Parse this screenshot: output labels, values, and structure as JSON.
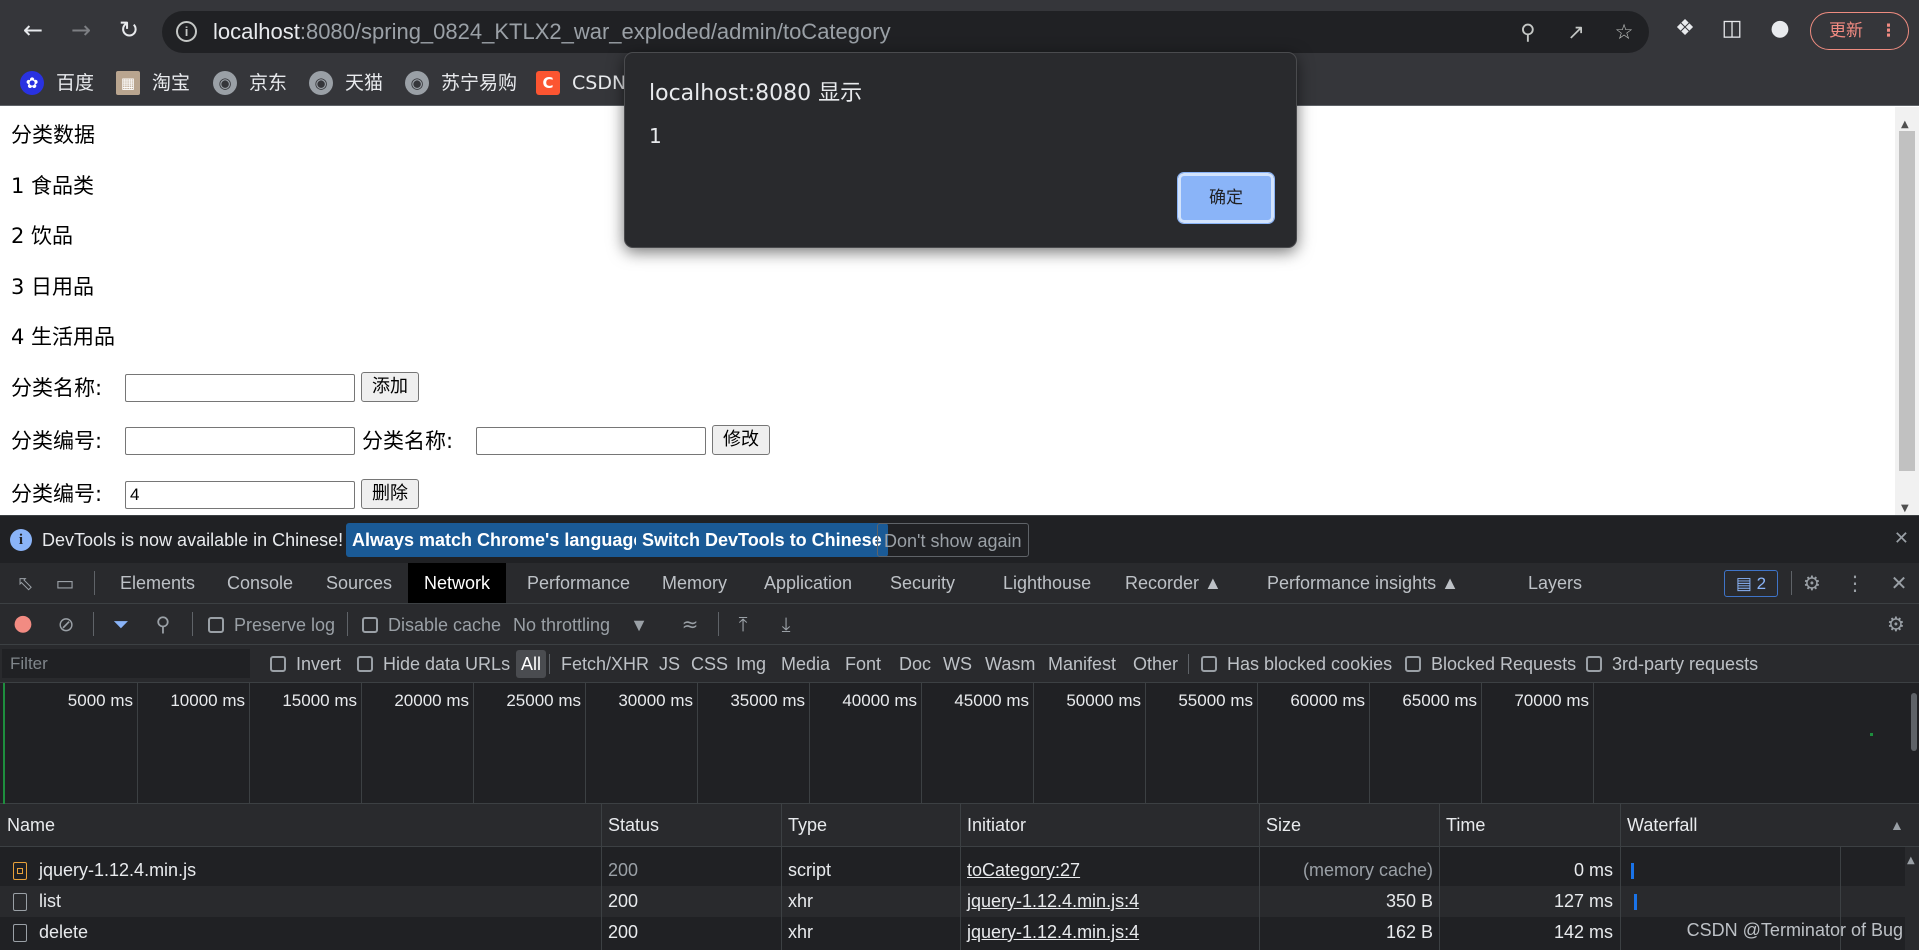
{
  "browser": {
    "url_host": "localhost",
    "url_rest": ":8080/spring_0824_KTLX2_war_exploded/admin/toCategory",
    "update_label": "更新",
    "bookmarks": [
      {
        "label": "百度",
        "icon": "baidu-icon"
      },
      {
        "label": "淘宝",
        "icon": "taobao-icon"
      },
      {
        "label": "京东",
        "icon": "globe-icon"
      },
      {
        "label": "天猫",
        "icon": "globe-icon"
      },
      {
        "label": "苏宁易购",
        "icon": "globe-icon"
      },
      {
        "label": "CSDN",
        "icon": "csdn-icon"
      }
    ]
  },
  "page": {
    "heading": "分类数据",
    "categories": [
      "1 食品类",
      "2 饮品",
      "3 日用品",
      "4 生活用品"
    ],
    "add_form": {
      "label": "分类名称:",
      "value": "",
      "button": "添加"
    },
    "update_form": {
      "id_label": "分类编号:",
      "id_value": "",
      "name_label": "分类名称:",
      "name_value": "",
      "button": "修改"
    },
    "delete_form": {
      "label": "分类编号:",
      "value": "4",
      "button": "删除"
    }
  },
  "alert": {
    "title": "localhost:8080 显示",
    "message": "1",
    "ok_label": "确定"
  },
  "devtools": {
    "banner": {
      "text": "DevTools is now available in Chinese!",
      "btn_match": "Always match Chrome's language",
      "btn_switch": "Switch DevTools to Chinese",
      "btn_dismiss": "Don't show again"
    },
    "tabs": [
      "Elements",
      "Console",
      "Sources",
      "Network",
      "Performance",
      "Memory",
      "Application",
      "Security",
      "Lighthouse",
      "Recorder",
      "Performance insights",
      "Layers"
    ],
    "active_tab": "Network",
    "issues_count": "2",
    "network_toolbar": {
      "preserve_log": "Preserve log",
      "disable_cache": "Disable cache",
      "throttling": "No throttling"
    },
    "filter": {
      "placeholder": "Filter",
      "invert": "Invert",
      "hide_data_urls": "Hide data URLs",
      "types": [
        "All",
        "Fetch/XHR",
        "JS",
        "CSS",
        "Img",
        "Media",
        "Font",
        "Doc",
        "WS",
        "Wasm",
        "Manifest",
        "Other"
      ],
      "active_type": "All",
      "has_blocked_cookies": "Has blocked cookies",
      "blocked_requests": "Blocked Requests",
      "third_party": "3rd-party requests"
    },
    "timeline_ticks": [
      "5000 ms",
      "10000 ms",
      "15000 ms",
      "20000 ms",
      "25000 ms",
      "30000 ms",
      "35000 ms",
      "40000 ms",
      "45000 ms",
      "50000 ms",
      "55000 ms",
      "60000 ms",
      "65000 ms",
      "70000 ms"
    ],
    "columns": [
      "Name",
      "Status",
      "Type",
      "Initiator",
      "Size",
      "Time",
      "Waterfall"
    ],
    "requests": [
      {
        "name": "jquery-1.12.4.min.js",
        "status": "200",
        "type": "script",
        "initiator": "toCategory:27",
        "size": "(memory cache)",
        "time": "0 ms"
      },
      {
        "name": "list",
        "status": "200",
        "type": "xhr",
        "initiator": "jquery-1.12.4.min.js:4",
        "size": "350 B",
        "time": "127 ms"
      },
      {
        "name": "delete",
        "status": "200",
        "type": "xhr",
        "initiator": "jquery-1.12.4.min.js:4",
        "size": "162 B",
        "time": "142 ms"
      }
    ]
  },
  "watermark": "CSDN @Terminator of Bug",
  "colors": {
    "accent": "#8ab4f8",
    "devtools_bg": "#202124",
    "chrome_bg": "#35363a"
  }
}
